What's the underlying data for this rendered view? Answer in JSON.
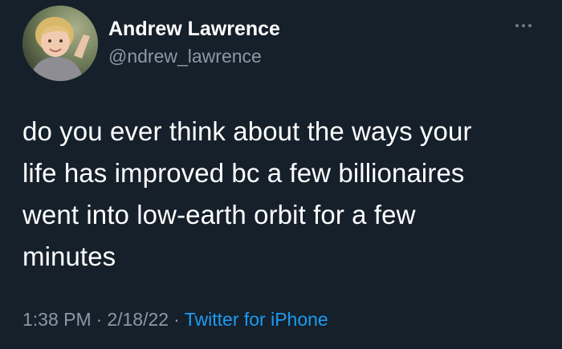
{
  "author": {
    "display_name": "Andrew Lawrence",
    "handle": "@ndrew_lawrence",
    "avatar_icon": "child-portrait-avatar"
  },
  "more_icon": "more-options-icon",
  "tweet": {
    "lines": [
      "do you ever think about the ways your",
      "life has improved bc a few billionaires",
      "went into low-earth orbit for a few",
      "minutes"
    ]
  },
  "meta": {
    "time": "1:38 PM",
    "separator": "·",
    "date": "2/18/22",
    "source": "Twitter for iPhone"
  },
  "colors": {
    "background": "#15202b",
    "text": "#ffffff",
    "secondary": "#8b98a5",
    "link": "#1d9bf0"
  }
}
